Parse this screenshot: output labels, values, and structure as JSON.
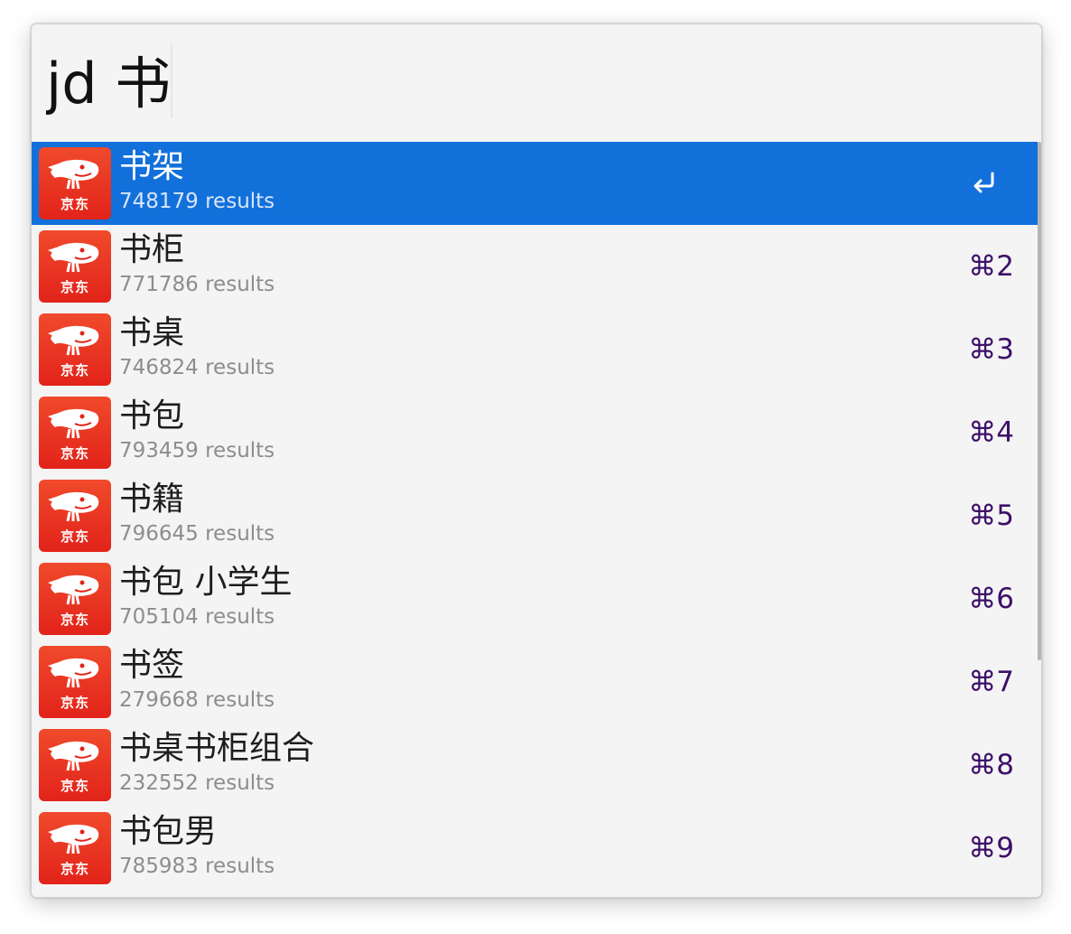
{
  "search": {
    "query": "jd 书"
  },
  "icon_label": "京东",
  "colors": {
    "selected_row": "#1270db",
    "shortcut": "#3d1068",
    "icon_bg": "#e2231a"
  },
  "results": [
    {
      "title": "书架",
      "subtitle": "748179 results",
      "shortcut": "",
      "selected": true,
      "action_icon": "return-icon"
    },
    {
      "title": "书柜",
      "subtitle": "771786 results",
      "shortcut": "⌘2"
    },
    {
      "title": "书桌",
      "subtitle": "746824 results",
      "shortcut": "⌘3"
    },
    {
      "title": "书包",
      "subtitle": "793459 results",
      "shortcut": "⌘4"
    },
    {
      "title": "书籍",
      "subtitle": "796645 results",
      "shortcut": "⌘5"
    },
    {
      "title": "书包 小学生",
      "subtitle": "705104 results",
      "shortcut": "⌘6"
    },
    {
      "title": "书签",
      "subtitle": "279668 results",
      "shortcut": "⌘7"
    },
    {
      "title": "书桌书柜组合",
      "subtitle": "232552 results",
      "shortcut": "⌘8"
    },
    {
      "title": "书包男",
      "subtitle": "785983 results",
      "shortcut": "⌘9"
    }
  ]
}
